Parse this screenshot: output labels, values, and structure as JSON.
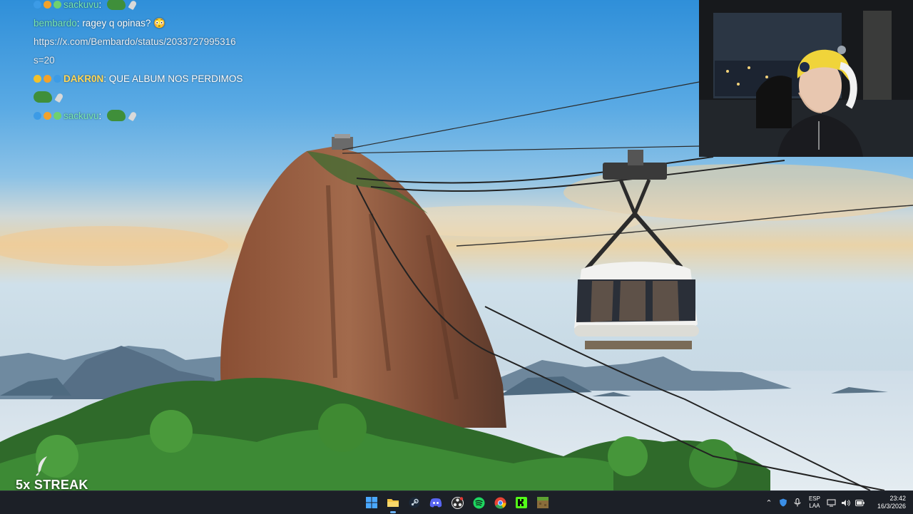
{
  "chat": {
    "messages": [
      {
        "user": "sackuvu",
        "sep": ": ",
        "text": "",
        "emote": "pepe-emote",
        "cut": true
      },
      {
        "user": "bembardo",
        "sep": ": ",
        "text": "ragey q opinas? 😳"
      },
      {
        "user": "",
        "sep": "",
        "text": "https://x.com/Bembardo/status/2033727995316"
      },
      {
        "user": "",
        "sep": "",
        "text": "s=20"
      },
      {
        "user": "DAKR0N",
        "sep": ": ",
        "text": "QUE ALBUM NOS PERDIMOS"
      },
      {
        "user": "",
        "sep": "",
        "text": "",
        "emote": "pepe-emote"
      },
      {
        "user": "sackuvu",
        "sep": ": ",
        "text": "",
        "emote": "pepe-emote"
      }
    ]
  },
  "streak": {
    "label": "5x STREAK",
    "icon": "feather-icon"
  },
  "taskbar": {
    "apps": [
      {
        "name": "start",
        "icon": "windows-icon",
        "color": "#4aa8ff"
      },
      {
        "name": "file-explorer",
        "icon": "folder-icon",
        "color": "#f5c542",
        "active": true
      },
      {
        "name": "steam",
        "icon": "steam-icon",
        "color": "#c7d5e0"
      },
      {
        "name": "discord",
        "icon": "discord-icon",
        "color": "#5865f2"
      },
      {
        "name": "obs",
        "icon": "obs-icon",
        "color": "#e8e8e8"
      },
      {
        "name": "spotify",
        "icon": "spotify-icon",
        "color": "#1ed760"
      },
      {
        "name": "chrome",
        "icon": "chrome-icon",
        "color": "#e94335"
      },
      {
        "name": "kick",
        "icon": "kick-icon",
        "color": "#53fc18"
      },
      {
        "name": "minecraft",
        "icon": "minecraft-icon",
        "color": "#8a6d3b"
      }
    ],
    "tray": {
      "language_line1": "ESP",
      "language_line2": "LAA",
      "time": "23:42",
      "date": "16/3/2026"
    }
  }
}
